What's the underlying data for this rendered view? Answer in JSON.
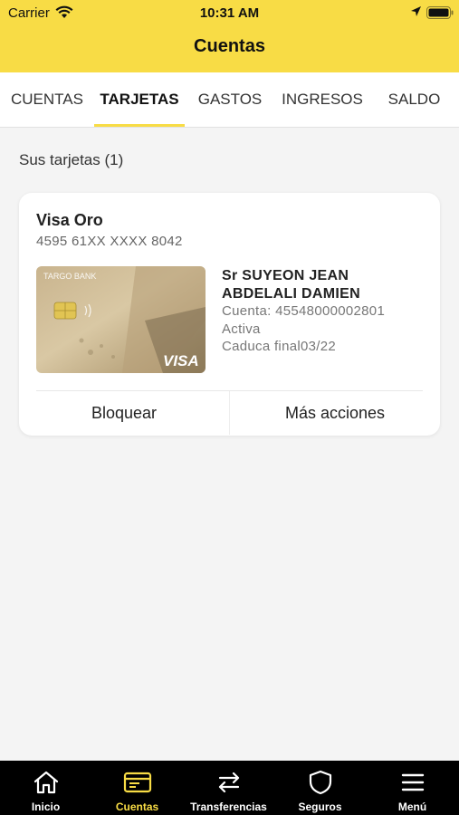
{
  "status_bar": {
    "carrier": "Carrier",
    "time": "10:31 AM"
  },
  "header": {
    "title": "Cuentas"
  },
  "tabs": [
    {
      "label": "CUENTAS"
    },
    {
      "label": "TARJETAS",
      "active": true
    },
    {
      "label": "GASTOS"
    },
    {
      "label": "INGRESOS"
    },
    {
      "label": "SALDO"
    }
  ],
  "section": {
    "label": "Sus tarjetas (1)"
  },
  "card": {
    "name": "Visa Oro",
    "number": "4595 61XX XXXX 8042",
    "holder_line1": "Sr SUYEON JEAN",
    "holder_line2": "ABDELALI DAMIEN",
    "account": "Cuenta: 45548000002801",
    "status": "Activa",
    "expiry": "Caduca final03/22",
    "image": {
      "bank_logo": "TARGO BANK",
      "network": "VISA"
    },
    "actions": {
      "block": "Bloquear",
      "more": "Más acciones"
    }
  },
  "tabbar": [
    {
      "label": "Inicio",
      "icon": "home-icon"
    },
    {
      "label": "Cuentas",
      "icon": "card-icon",
      "active": true
    },
    {
      "label": "Transferencias",
      "icon": "transfer-icon"
    },
    {
      "label": "Seguros",
      "icon": "shield-icon"
    },
    {
      "label": "Menú",
      "icon": "menu-icon"
    }
  ],
  "colors": {
    "accent": "#f8dc45",
    "tabbar_bg": "#000000",
    "background": "#f4f4f4"
  }
}
